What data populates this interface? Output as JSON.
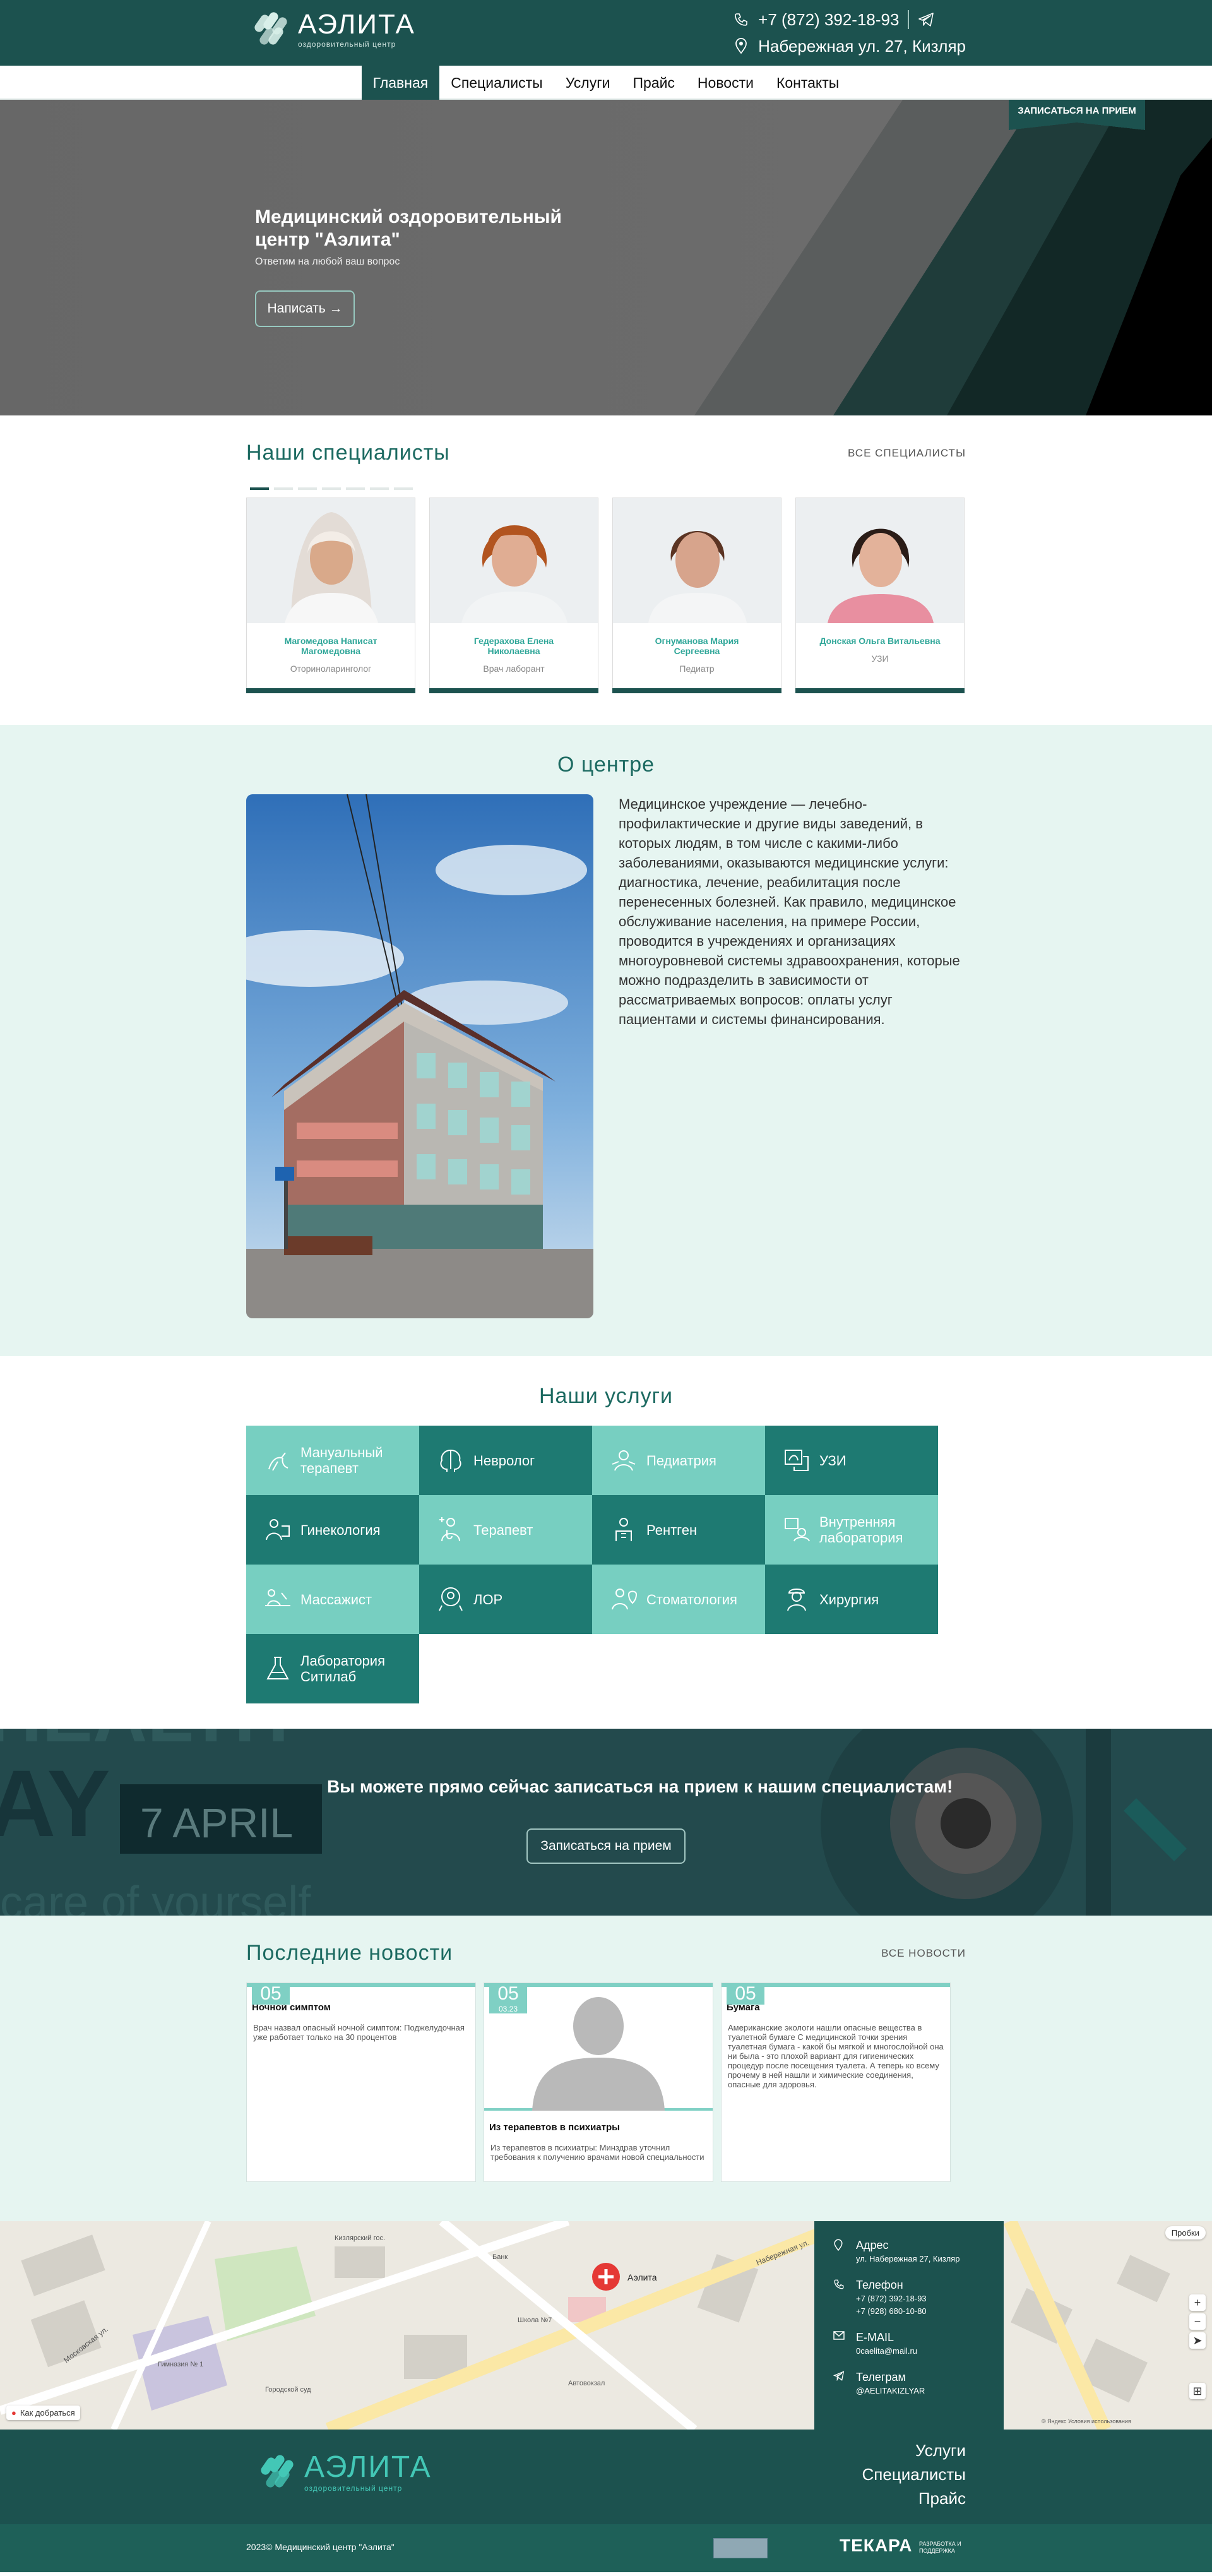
{
  "header": {
    "logo_title": "АЭЛИТА",
    "logo_subtitle": "оздоровительный центр",
    "phone": "+7 (872) 392-18-93",
    "address": "Набережная ул. 27, Кизляр"
  },
  "nav": {
    "items": [
      {
        "label": "Главная",
        "active": true
      },
      {
        "label": "Специалисты"
      },
      {
        "label": "Услуги"
      },
      {
        "label": "Прайс"
      },
      {
        "label": "Новости"
      },
      {
        "label": "Контакты"
      }
    ]
  },
  "hero": {
    "title": "Медицинский оздоровительный центр \"Аэлита\"",
    "subtitle": "Ответим на любой ваш вопрос",
    "button": "Написать →",
    "book_tag": "ЗАПИСАТЬСЯ НА ПРИЕМ"
  },
  "specialists": {
    "title": "Наши специалисты",
    "all_link": "ВСЕ СПЕЦИАЛИСТЫ",
    "cards": [
      {
        "name": "Магомедова Написат Магомедовна",
        "role": "Оториноларинголог"
      },
      {
        "name": "Гедерахова Елена Николаевна",
        "role": "Врач лаборант"
      },
      {
        "name": "Огнуманова Мария Сергеевна",
        "role": "Педиатр"
      },
      {
        "name": "Донская Ольга Витальевна",
        "role": "УЗИ"
      }
    ]
  },
  "about": {
    "title": "О центре",
    "text": "Медицинское учреждение — лечебно-профилактические и другие виды заведений, в которых людям, в том числе с какими-либо заболеваниями, оказываются медицинские услуги: диагностика, лечение, реабилитация после перенесенных болезней. Как правило, медицинское обслуживание населения, на примере России, проводится в учреждениях и организациях многоуровневой системы здравоохранения, которые можно подразделить в зависимости от рассматриваемых вопросов: оплаты услуг пациентами и системы финансирования."
  },
  "services": {
    "title": "Наши услуги",
    "tiles": [
      {
        "label": "Мануальный терапевт",
        "tone": "light",
        "icon": "hands-icon"
      },
      {
        "label": "Невролог",
        "tone": "dark",
        "icon": "brain-icon"
      },
      {
        "label": "Педиатрия",
        "tone": "light",
        "icon": "baby-icon"
      },
      {
        "label": "УЗИ",
        "tone": "dark",
        "icon": "ultrasound-icon"
      },
      {
        "label": "Гинекология",
        "tone": "dark",
        "icon": "gynecology-icon"
      },
      {
        "label": "Терапевт",
        "tone": "light",
        "icon": "therapist-icon"
      },
      {
        "label": "Рентген",
        "tone": "dark",
        "icon": "xray-icon"
      },
      {
        "label": "Внутренняя лаборатория",
        "tone": "light",
        "icon": "lab-icon"
      },
      {
        "label": "Массажист",
        "tone": "light",
        "icon": "massage-icon"
      },
      {
        "label": "ЛОР",
        "tone": "dark",
        "icon": "ent-icon"
      },
      {
        "label": "Стоматология",
        "tone": "light",
        "icon": "tooth-icon"
      },
      {
        "label": "Хирургия",
        "tone": "dark",
        "icon": "surgeon-icon"
      },
      {
        "label": "Лаборатория Ситилаб",
        "tone": "dark",
        "icon": "flask-icon"
      }
    ]
  },
  "banner": {
    "text": "Вы можете прямо сейчас записаться на прием к нашим специалистам!",
    "button": "Записаться на прием",
    "bg_text_day": "AY",
    "bg_text_date": "7 APRIL",
    "bg_text_care": "care of yourself"
  },
  "news": {
    "title": "Последние новости",
    "all_link": "ВСЕ НОВОСТИ",
    "items": [
      {
        "day": "05",
        "title": "Ночной симптом",
        "text": "Врач назвал опасный ночной симптом: Поджелудочная уже работает только на 30 процентов"
      },
      {
        "day": "05",
        "month": "03.23",
        "title": "Из терапевтов в психиатры",
        "text": "Из терапевтов в психиатры: Минздрав уточнил требования к получению врачами новой специальности"
      },
      {
        "day": "05",
        "title": "Бумага",
        "text": "Американские экологи нашли опасные вещества в туалетной бумаге С медицинской точки зрения туалетная бумага - какой бы мягкой и многослойной она ни была - это плохой вариант для гигиенических процедур после посещения туалета. А теперь ко всему прочему в ней нашли и химические соединения, опасные для здоровья."
      }
    ]
  },
  "map": {
    "marker_label": "Аэлита",
    "route_link": "Как добраться",
    "traffic": "Пробки",
    "attribution": "© Яндекс  Условия использования",
    "streets": [
      "Московская ул.",
      "Набережная ул.",
      "Гимназия № 1",
      "Кизлярский гос.",
      "Школа №7",
      "Банк",
      "Городской суд",
      "Автовокзал"
    ],
    "address_label": "Адрес",
    "address": "ул. Набережная 27, Кизляр",
    "phone_label": "Телефон",
    "phones": [
      "+7 (872) 392-18-93",
      "+7 (928) 680-10-80"
    ],
    "email_label": "E-MAIL",
    "email": "0caelita@mail.ru",
    "telegram_label": "Телеграм",
    "telegram": "@AELITAKIZLYAR"
  },
  "footer": {
    "logo_title": "АЭЛИТА",
    "logo_subtitle": "оздоровительный центр",
    "links": [
      "Услуги",
      "Специалисты",
      "Прайс"
    ],
    "copyright": "2023© Медицинский центр \"Аэлита\"",
    "dev_name": "ТЕКАРА",
    "dev_sub": "РАЗРАБОТКА И ПОДДЕРЖКА"
  },
  "colors": {
    "primary": "#1c524f",
    "tile_light": "#77cfc1",
    "tile_dark": "#1e7a72",
    "accent_text": "#2ea698",
    "soft_bg": "#e6f5f1"
  }
}
